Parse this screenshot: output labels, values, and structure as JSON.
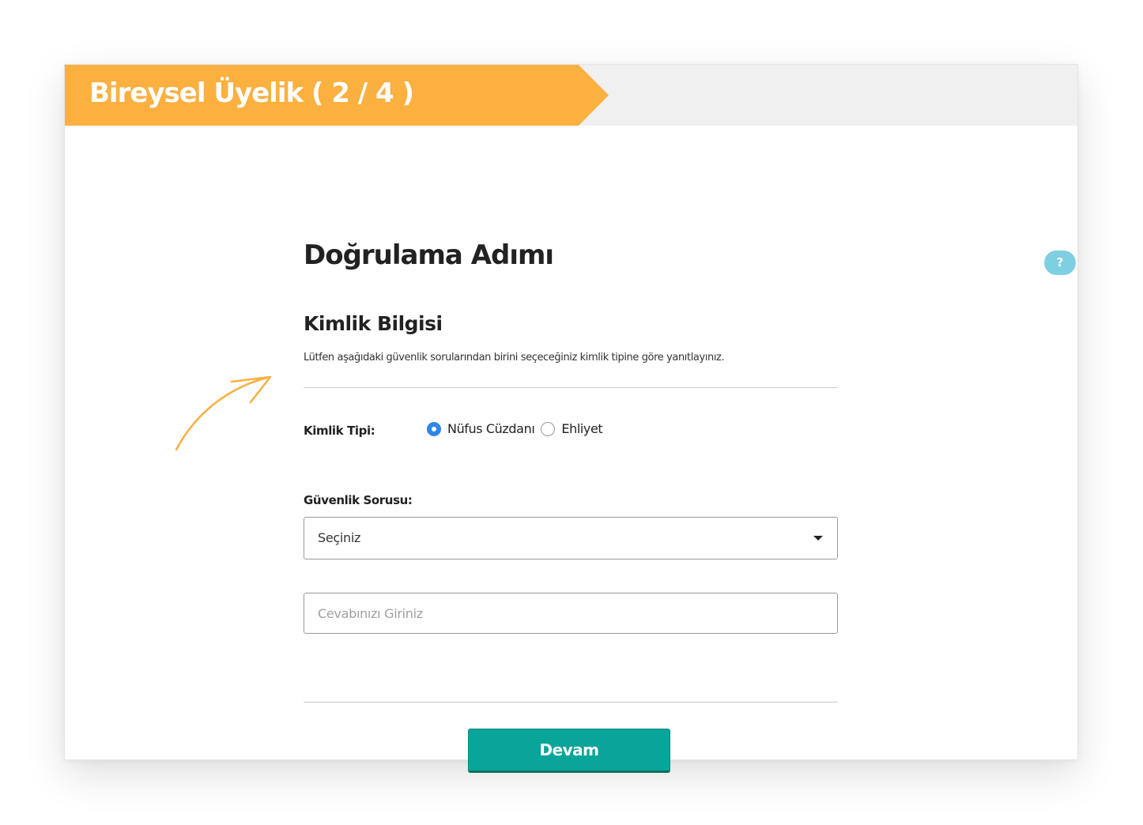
{
  "header": {
    "title": "Bireysel Üyelik ( 2 / 4 )"
  },
  "page": {
    "title": "Doğrulama Adımı",
    "help_icon": "?"
  },
  "identity_section": {
    "title": "Kimlik Bilgisi",
    "description": "Lütfen aşağıdaki güvenlik sorularından birini seçeceğiniz kimlik tipine göre yanıtlayınız."
  },
  "id_type": {
    "label": "Kimlik Tipi:",
    "options": [
      {
        "label": "Nüfus Cüzdanı",
        "checked": true
      },
      {
        "label": "Ehliyet",
        "checked": false
      }
    ]
  },
  "security_question": {
    "label": "Güvenlik Sorusu:",
    "selected": "Seçiniz"
  },
  "answer": {
    "placeholder": "Cevabınızı Giriniz",
    "value": ""
  },
  "actions": {
    "continue_label": "Devam"
  },
  "colors": {
    "ribbon": "#fbb040",
    "primary_button": "#0aa59a",
    "radio_selected": "#2f87e8",
    "help_icon": "#7fcfe3"
  }
}
